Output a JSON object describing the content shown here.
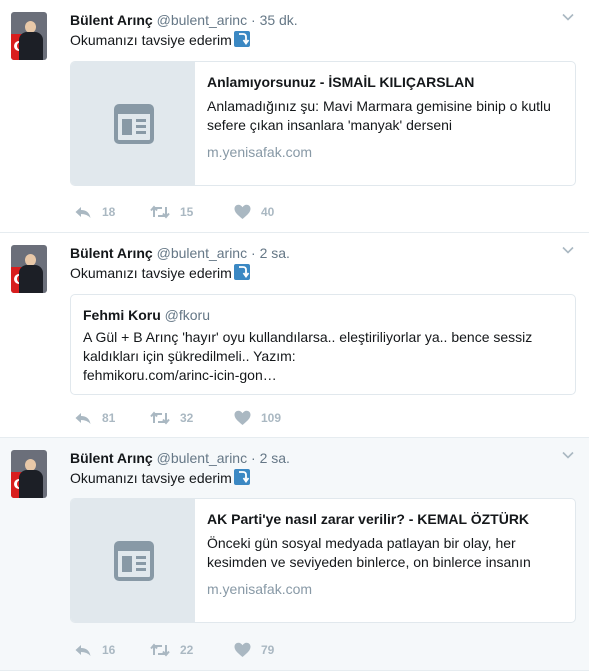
{
  "tweets": [
    {
      "author": "Bülent Arınç",
      "handle": "@bulent_arinc",
      "sep": "·",
      "time": "35 dk.",
      "text": "Okumanızı tavsiye ederim",
      "card": {
        "title": "Anlamıyorsunuz - İSMAİL KILIÇARSLAN",
        "desc_line1": "Anlamadığınız şu: Mavi Marmara gemisine binip o kutlu",
        "desc_line2": "sefere çıkan insanlara 'manyak' derseni",
        "desc_line3": "",
        "domain": "m.yenisafak.com"
      },
      "replies": "18",
      "retweets": "15",
      "likes": "40"
    },
    {
      "author": "Bülent Arınç",
      "handle": "@bulent_arinc",
      "sep": "·",
      "time": "2 sa.",
      "text": "Okumanızı tavsiye ederim",
      "quote": {
        "author": "Fehmi Koru",
        "handle": "@fkoru",
        "line1": "A Gül + B Arınç 'hayır' oyu kullandılarsa.. eleştiriliyorlar ya.. bence sessiz",
        "line2": "kaldıkları için şükredilmeli.. Yazım:",
        "line3": "fehmikoru.com/arinc-icin-gon…"
      },
      "replies": "81",
      "retweets": "32",
      "likes": "109"
    },
    {
      "author": "Bülent Arınç",
      "handle": "@bulent_arinc",
      "sep": "·",
      "time": "2 sa.",
      "text": "Okumanızı tavsiye ederim",
      "card": {
        "title": "AK Parti'ye nasıl zarar verilir? - KEMAL ÖZTÜRK",
        "desc_line1": "Önceki gün sosyal medyada patlayan bir olay, her",
        "desc_line2": "kesimden ve seviyeden binlerce, on binlerce insanın",
        "desc_line3": "",
        "domain": "m.yenisafak.com"
      },
      "replies": "16",
      "retweets": "22",
      "likes": "79"
    }
  ],
  "icons": {
    "reply": "reply-icon",
    "retweet": "retweet-icon",
    "like": "heart-icon",
    "caret": "chevron-down-icon",
    "link_emoji": "curved-arrow-emoji-icon",
    "card_placeholder": "article-icon"
  },
  "colors": {
    "text": "#14171a",
    "muted": "#657786",
    "action": "#aab8c2",
    "border": "#e1e8ed",
    "hover_bg": "#f5f8fa",
    "emoji_blue": "#3b88c3"
  }
}
